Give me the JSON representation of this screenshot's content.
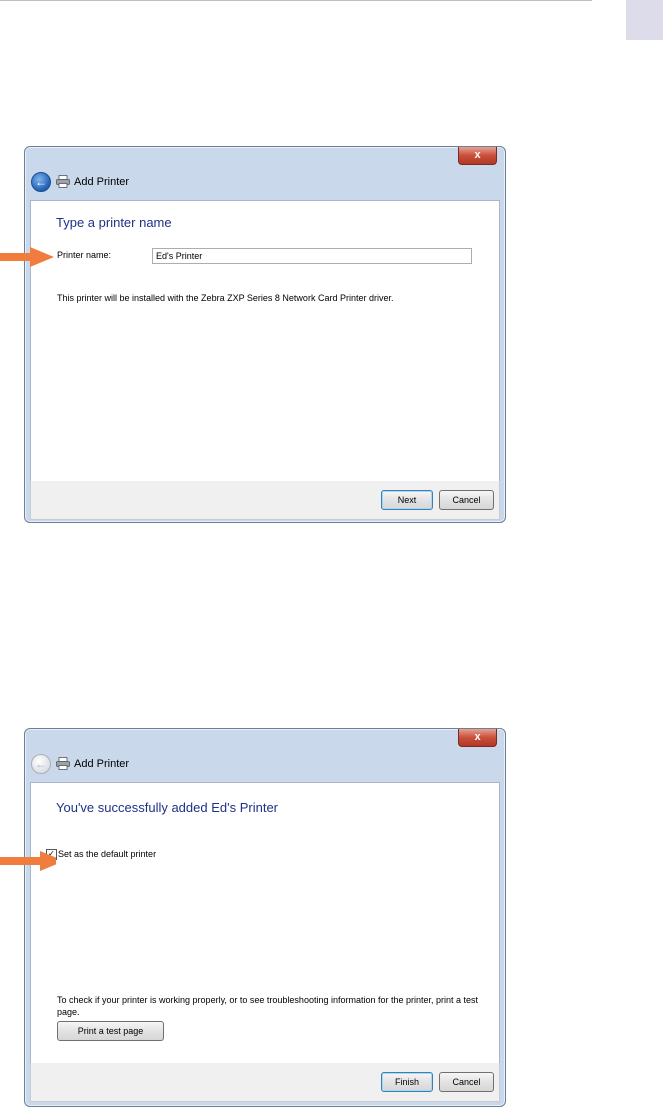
{
  "dialog1": {
    "window_title": "Add Printer",
    "close_label": "x",
    "heading": "Type a printer name",
    "printer_name_label": "Printer name:",
    "printer_name_value": "Ed's Printer",
    "driver_message": "This printer will be installed with the Zebra ZXP Series 8 Network Card Printer driver.",
    "next_label": "Next",
    "cancel_label": "Cancel"
  },
  "dialog2": {
    "window_title": "Add Printer",
    "close_label": "x",
    "heading": "You've successfully added Ed's Printer",
    "default_checkbox_label": "Set as the default printer",
    "default_checked": true,
    "test_info": "To check if your printer is working properly, or to see troubleshooting information for the printer, print a test page.",
    "print_test_label": "Print a test page",
    "finish_label": "Finish",
    "cancel_label": "Cancel"
  },
  "colors": {
    "arrow": "#f07c3e",
    "heading": "#1e3287"
  },
  "icons": [
    "back-arrow-icon",
    "printer-icon",
    "close-icon",
    "checkmark-icon",
    "pointer-arrow-icon"
  ]
}
